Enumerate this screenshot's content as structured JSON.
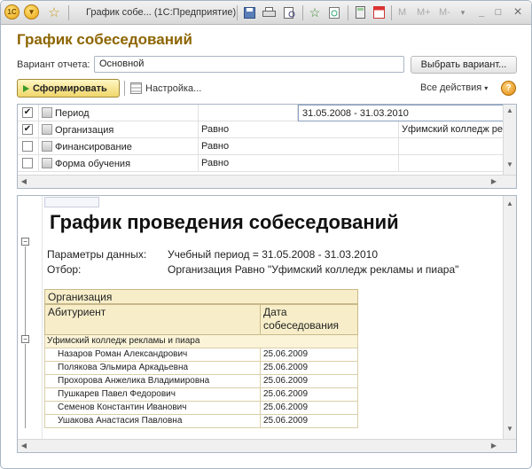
{
  "window": {
    "title": "График собе...   (1С:Предприятие)",
    "toolbar_m": "M",
    "toolbar_mplus": "M+",
    "toolbar_mminus": "M-",
    "minimize": "_",
    "maximize": "□",
    "close": "×",
    "logo": "1С"
  },
  "form": {
    "caption": "График собеседований",
    "variant_label": "Вариант отчета:",
    "variant_value": "Основной",
    "choose_variant": "Выбрать вариант...",
    "generate": "Сформировать",
    "settings": "Настройка...",
    "all_actions": "Все действия",
    "help": "?"
  },
  "settings_grid": {
    "rows": [
      {
        "checked": "✔",
        "name": "Период",
        "cond": "",
        "value": "31.05.2008 - 31.03.2010"
      },
      {
        "checked": "✔",
        "name": "Организация",
        "cond": "Равно",
        "value": "Уфимский колледж ре"
      },
      {
        "checked": "",
        "name": "Финансирование",
        "cond": "Равно",
        "value": ""
      },
      {
        "checked": "",
        "name": "Форма обучения",
        "cond": "Равно",
        "value": ""
      }
    ]
  },
  "report": {
    "title": "График проведения собеседований",
    "params_label": "Параметры данных:",
    "params_value": "Учебный период = 31.05.2008 - 31.03.2010",
    "filter_label": "Отбор:",
    "filter_value": "Организация Равно \"Уфимский колледж рекламы и пиара\"",
    "col_org": "Организация",
    "col_applicant": "Абитуриент",
    "col_date": "Дата\nсобеседования",
    "group": "Уфимский колледж рекламы и пиара",
    "rows": [
      {
        "name": "Назаров Роман Александрович",
        "date": "25.06.2009"
      },
      {
        "name": "Полякова Эльмира Аркадьевна",
        "date": "25.06.2009"
      },
      {
        "name": "Прохорова Анжелика Владимировна",
        "date": "25.06.2009"
      },
      {
        "name": "Пушкарев Павел Федорович",
        "date": "25.06.2009"
      },
      {
        "name": "Семенов Константин Иванович",
        "date": "25.06.2009"
      },
      {
        "name": "Ушакова  Анастасия Павловна",
        "date": "25.06.2009"
      }
    ]
  },
  "icons": [
    "app-logo-icon",
    "menu-icon",
    "star-icon",
    "save-icon",
    "print-icon",
    "preview-icon",
    "add-favorite-icon",
    "history-icon",
    "calculator-icon",
    "calendar-icon",
    "gear-icon",
    "funnel-icon",
    "help-icon",
    "generate-icon"
  ]
}
